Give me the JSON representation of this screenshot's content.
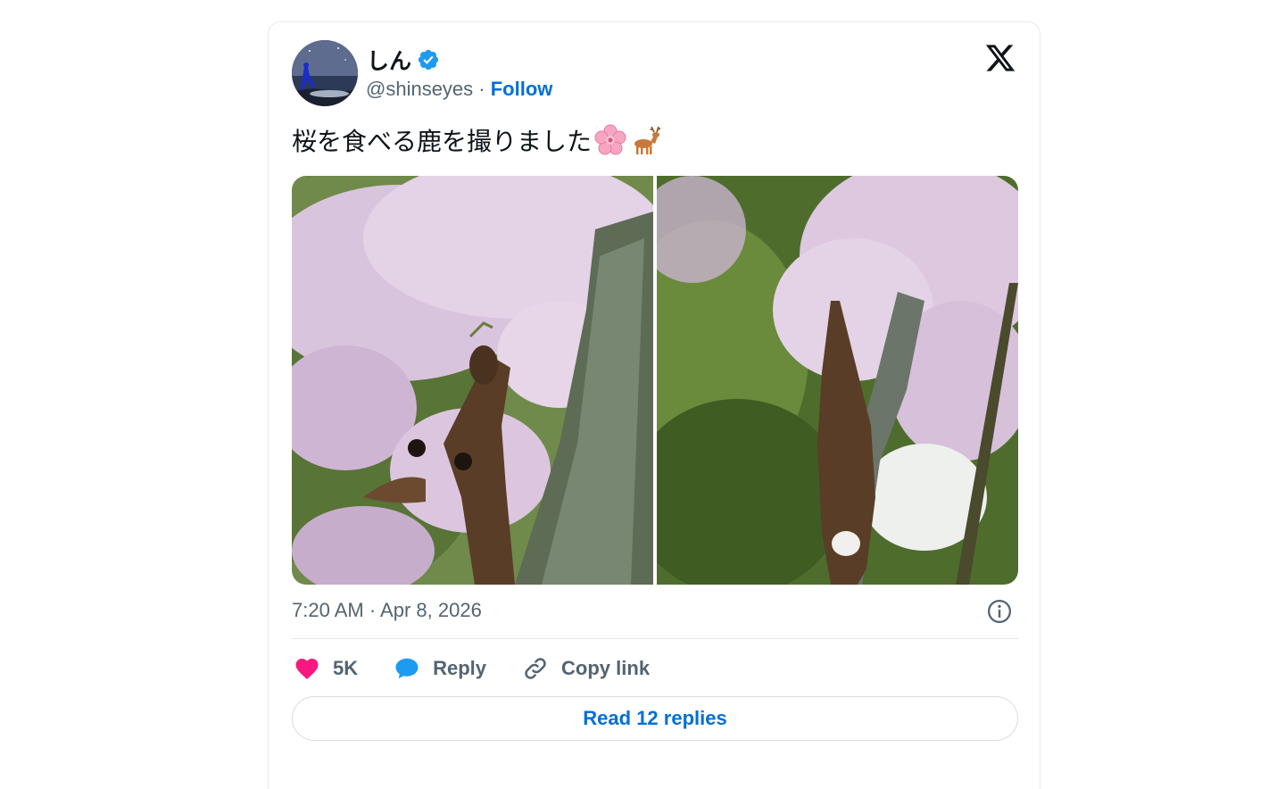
{
  "tweet": {
    "author": {
      "display_name": "しん",
      "handle": "@shinseyes",
      "verified": true,
      "follow_label": "Follow",
      "separator": " · "
    },
    "text": "桜を食べる鹿を撮りました",
    "emojis": [
      "cherry-blossom-icon",
      "deer-icon"
    ],
    "media": [
      {
        "subject": "deer eating cherry blossoms close-up"
      },
      {
        "subject": "deer standing on hind legs reaching cherry blossoms"
      }
    ],
    "timestamp": "7:20 AM · Apr 8, 2026",
    "actions": {
      "like_count": "5K",
      "reply_label": "Reply",
      "copy_link_label": "Copy link"
    },
    "read_replies_label": "Read 12 replies"
  },
  "colors": {
    "link": "#006fd6",
    "muted": "#536471",
    "heart": "#f91880",
    "reply": "#1d9bf0",
    "verified": "#1d9bf0"
  }
}
